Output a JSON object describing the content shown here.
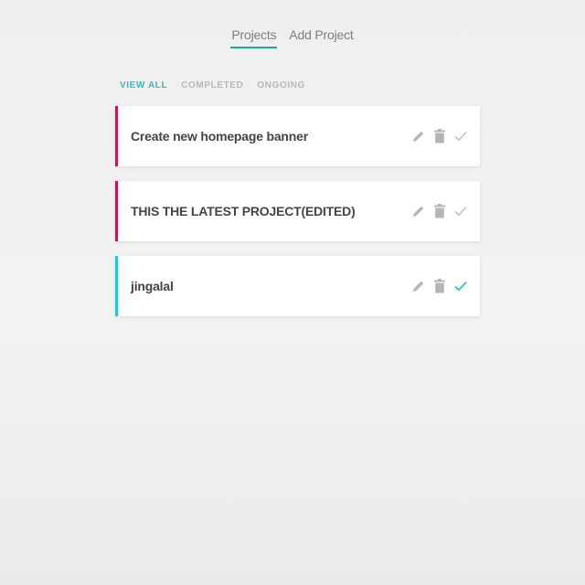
{
  "nav": {
    "items": [
      {
        "label": "Projects",
        "active": true
      },
      {
        "label": "Add Project",
        "active": false
      }
    ]
  },
  "filters": [
    {
      "label": "VIEW ALL",
      "active": true
    },
    {
      "label": "COMPLETED",
      "active": false
    },
    {
      "label": "ONGOING",
      "active": false
    }
  ],
  "projects": [
    {
      "title": "Create new homepage banner",
      "completed": false
    },
    {
      "title": "THIS THE LATEST PROJECT(EDITED)",
      "completed": false
    },
    {
      "title": "jingalal",
      "completed": true
    }
  ],
  "icons": {
    "edit": "pencil-icon",
    "delete": "trash-icon",
    "complete": "check-icon"
  },
  "colors": {
    "accent_teal": "#1aa99a",
    "filter_active": "#3fb6c3",
    "ongoing_border": "#c2185b",
    "completed_border": "#26c6da",
    "icon_gray": "#b5b5b5",
    "check_done": "#26c6da"
  }
}
